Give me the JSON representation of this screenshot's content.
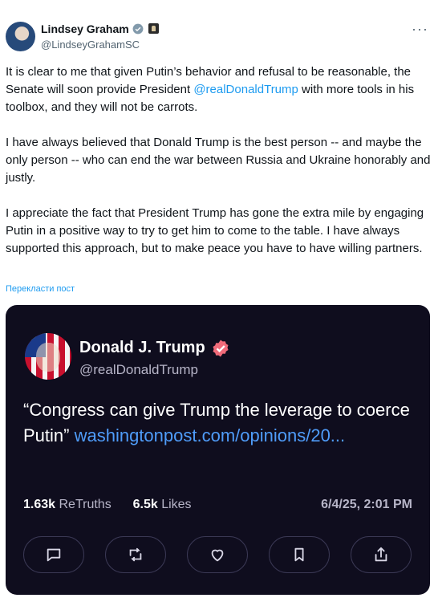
{
  "author": {
    "name": "Lindsey Graham",
    "handle": "@LindseyGrahamSC"
  },
  "tweet": {
    "p1_before": "It is clear to me that given Putin’s behavior and refusal to be reasonable, the Senate will soon provide President ",
    "p1_mention": "@realDonaldTrump",
    "p1_after": " with more tools in his toolbox, and they will not be carrots.",
    "p2": "I have always believed that Donald Trump is the best person -- and maybe the only person -- who can end the war between Russia and Ukraine honorably and justly.",
    "p3": "I appreciate the fact that President Trump has gone the extra mile by engaging Putin in a positive way to try to get him to come to the table.  I have always supported this approach, but to make peace you have to have willing partners."
  },
  "translate_label": "Перекласти пост",
  "card": {
    "name": "Donald J. Trump",
    "handle": "@realDonaldTrump",
    "post_text": "“Congress can give Trump the leverage to coerce Putin” ",
    "post_link": "washingtonpost.com/opinions/20...",
    "retruths_count": "1.63k",
    "retruths_label": "ReTruths",
    "likes_count": "6.5k",
    "likes_label": "Likes",
    "date": "6/4/25, 2:01 PM",
    "actions": [
      "reply-icon",
      "retruth-icon",
      "like-icon",
      "bookmark-icon",
      "share-icon"
    ]
  },
  "colors": {
    "link": "#1d9bf0",
    "card_background": "#0f0d1e",
    "card_link": "#4f9cf9",
    "verified": "#1d9bf0",
    "truth_verified": "#f06b7a"
  }
}
